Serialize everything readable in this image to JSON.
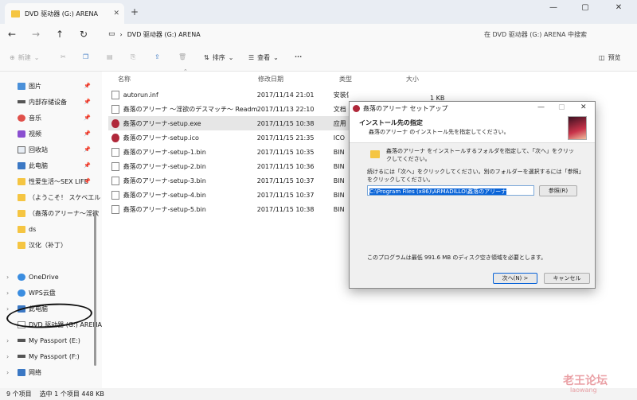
{
  "window": {
    "tab_title": "DVD 驱动器 (G:) ARENA",
    "minimize_icon": "minimize-icon",
    "maximize_icon": "maximize-icon",
    "close_icon": "close-icon"
  },
  "address": {
    "path": "DVD 驱动器 (G:) ARENA",
    "search_placeholder": "在 DVD 驱动器 (G:) ARENA 中搜索"
  },
  "toolbar": {
    "new_label": "新建",
    "sort_label": "排序",
    "view_label": "查看",
    "more_label": "···",
    "preview_label": "预览"
  },
  "sidebar": {
    "items": [
      {
        "label": "图片",
        "icon": "pictures-icon",
        "pinned": true
      },
      {
        "label": "内部存储设备",
        "icon": "drive-icon",
        "pinned": true
      },
      {
        "label": "音乐",
        "icon": "music-icon",
        "pinned": true
      },
      {
        "label": "视频",
        "icon": "video-icon",
        "pinned": true
      },
      {
        "label": "回收站",
        "icon": "recycle-bin-icon",
        "pinned": true
      },
      {
        "label": "此电脑",
        "icon": "computer-icon",
        "pinned": true
      },
      {
        "label": "性爱生活～SEX LIFE",
        "icon": "folder-icon",
        "pinned": true
      },
      {
        "label": "（ようこそ！ スケベエル",
        "icon": "folder-icon",
        "pinned": false
      },
      {
        "label": "（姦落のアリーナ～淫欲",
        "icon": "folder-icon",
        "pinned": false
      },
      {
        "label": "ds",
        "icon": "folder-icon",
        "pinned": false
      },
      {
        "label": "汉化（补丁）",
        "icon": "folder-icon",
        "pinned": false
      },
      {
        "label": "OneDrive",
        "icon": "cloud-icon",
        "pinned": false
      },
      {
        "label": "WPS云盘",
        "icon": "cloud-icon",
        "pinned": false
      },
      {
        "label": "此电脑",
        "icon": "computer-icon",
        "pinned": false
      },
      {
        "label": "DVD 驱动器 (G:) ARENA",
        "icon": "disc-icon",
        "pinned": false
      },
      {
        "label": "My Passport (E:)",
        "icon": "drive-icon",
        "pinned": false
      },
      {
        "label": "My Passport (F:)",
        "icon": "drive-icon",
        "pinned": false
      },
      {
        "label": "网络",
        "icon": "network-icon",
        "pinned": false
      }
    ]
  },
  "columns": {
    "name": "名称",
    "date": "修改日期",
    "type": "类型",
    "size": "大小"
  },
  "files": [
    {
      "name": "autorun.inf",
      "date": "2017/11/14 21:01",
      "type": "安装信息",
      "size": "1 KB",
      "icon": "document-icon"
    },
    {
      "name": "姦落のアリーナ ～淫欲のデスマッチ～ Readm...",
      "date": "2017/11/13 22:10",
      "type": "文档",
      "size": "",
      "icon": "document-icon"
    },
    {
      "name": "姦落のアリーナ-setup.exe",
      "date": "2017/11/15 10:38",
      "type": "应用",
      "size": "",
      "icon": "app-icon"
    },
    {
      "name": "姦落のアリーナ-setup.ico",
      "date": "2017/11/15 21:35",
      "type": "ICO",
      "size": "",
      "icon": "app-icon"
    },
    {
      "name": "姦落のアリーナ-setup-1.bin",
      "date": "2017/11/15 10:35",
      "type": "BIN",
      "size": "",
      "icon": "document-icon"
    },
    {
      "name": "姦落のアリーナ-setup-2.bin",
      "date": "2017/11/15 10:36",
      "type": "BIN",
      "size": "",
      "icon": "document-icon"
    },
    {
      "name": "姦落のアリーナ-setup-3.bin",
      "date": "2017/11/15 10:37",
      "type": "BIN",
      "size": "",
      "icon": "document-icon"
    },
    {
      "name": "姦落のアリーナ-setup-4.bin",
      "date": "2017/11/15 10:37",
      "type": "BIN",
      "size": "",
      "icon": "document-icon"
    },
    {
      "name": "姦落のアリーナ-setup-5.bin",
      "date": "2017/11/15 10:38",
      "type": "BIN",
      "size": "",
      "icon": "document-icon"
    }
  ],
  "status": {
    "count": "9 个项目",
    "selection": "选中 1 个项目  448 KB"
  },
  "dialog": {
    "title": "姦落のアリーナ セットアップ",
    "heading": "インストール先の指定",
    "subheading": "姦落のアリーナ のインストール先を指定してください。",
    "instruction": "姦落のアリーナ をインストールするフォルダを指定して、「次へ」をクリックしてください。",
    "continue_text": "続けるには「次へ」をクリックしてください。別のフォルダーを選択するには「参照」をクリックしてください。",
    "install_path": "C:\\Program Files (x86)\\ARMADILLO\\姦落のアリーナ",
    "browse_label": "参照(R)",
    "space_text": "このプログラムは最低 991.6 MB のディスク空き領域を必要とします。",
    "next_label": "次へ(N) >",
    "cancel_label": "キャンセル"
  },
  "watermark": {
    "text": "老王论坛",
    "sub": "laowang"
  },
  "colors": {
    "accent": "#0a64d8",
    "folder": "#f5c542",
    "selected_row": "#e6e6e6"
  }
}
